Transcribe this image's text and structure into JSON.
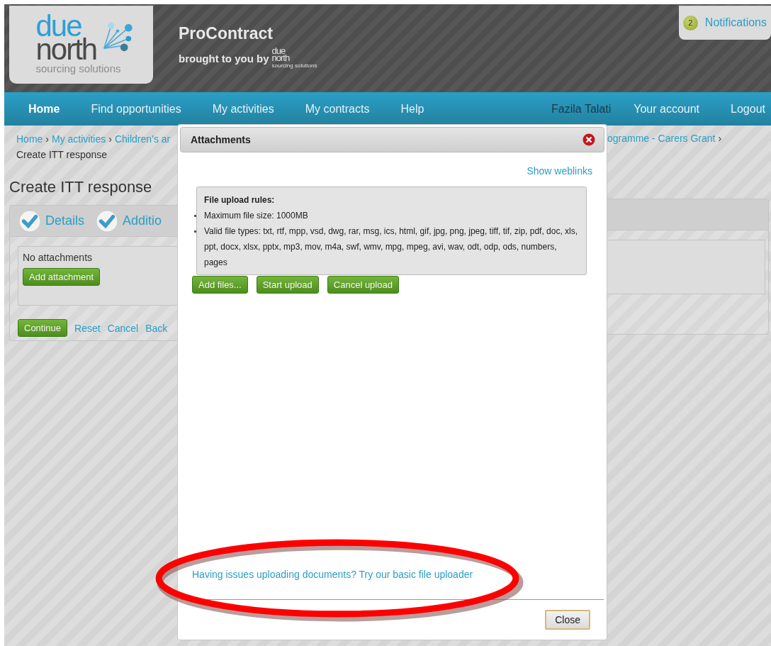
{
  "header": {
    "logo": {
      "word_1": "due",
      "word_2": "north",
      "tagline": "sourcing solutions"
    },
    "title": "ProContract",
    "byline": "brought to you by",
    "byline_logo": {
      "word_1": "due",
      "word_2": "north",
      "tagline": "sourcing solutions"
    },
    "notifications": {
      "count": "2",
      "label": "Notifications"
    }
  },
  "nav": {
    "items": [
      {
        "label": "Home",
        "selected": true
      },
      {
        "label": "Find opportunities",
        "selected": false
      },
      {
        "label": "My activities",
        "selected": false
      },
      {
        "label": "My contracts",
        "selected": false
      },
      {
        "label": "Help",
        "selected": false
      }
    ],
    "user_items": [
      {
        "label": "Fazila Talati",
        "kind": "user"
      },
      {
        "label": "Your account",
        "kind": "link"
      },
      {
        "label": "Logout",
        "kind": "link"
      }
    ]
  },
  "breadcrumb": {
    "separator": "›",
    "links": [
      "Home",
      "My activities",
      "Children’s ar"
    ],
    "current": "Create ITT response",
    "right_link": "ogramme - Carers Grant"
  },
  "page": {
    "heading": "Create ITT response",
    "steps": [
      {
        "label": "Details",
        "checked": true
      },
      {
        "label": "Additio",
        "checked": true
      }
    ],
    "attachments_text": "No attachments",
    "add_button": "Add attachment",
    "continue_button": "Continue",
    "links": [
      "Reset",
      "Cancel",
      "Back"
    ]
  },
  "modal": {
    "title": "Attachments",
    "weblinks": "Show weblinks",
    "rules": {
      "title": "File upload rules:",
      "items": [
        "Maximum file size: 1000MB",
        "Valid file types: txt, rtf, mpp, vsd, dwg, rar, msg, ics, html, gif, jpg, png, jpeg, tiff, tif, zip, pdf, doc, xls, ppt, docx, xlsx, pptx, mp3, mov, m4a, swf, wmv, mpg, mpeg, avi, wav, odt, odp, ods, numbers, pages"
      ]
    },
    "buttons": [
      "Add files...",
      "Start upload",
      "Cancel upload"
    ],
    "basic_link": "Having issues uploading documents? Try our basic file uploader",
    "close_button": "Close"
  },
  "annotation": {
    "color": "#ff0000"
  }
}
